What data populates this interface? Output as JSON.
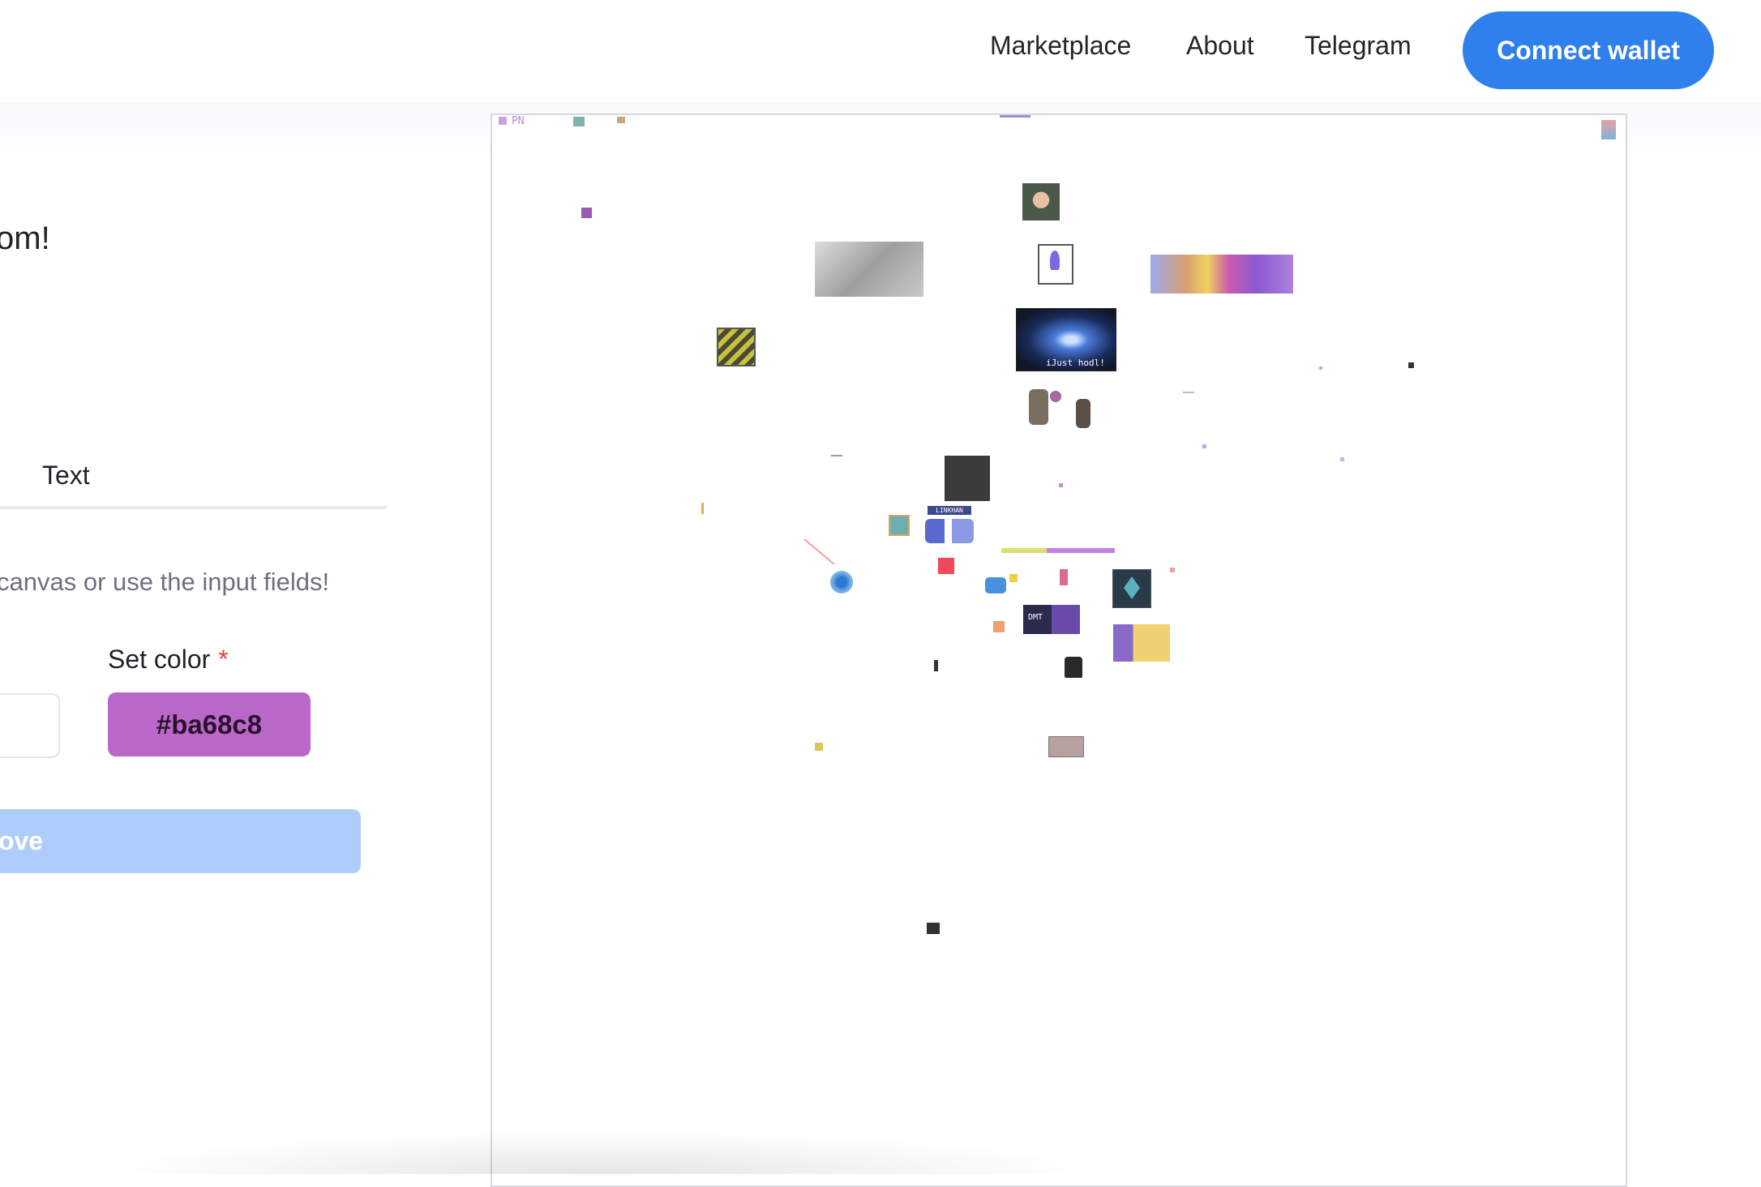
{
  "nav": {
    "marketplace_label": "Marketplace",
    "about_label": "About",
    "telegram_label": "Telegram",
    "connect_label": "Connect wallet"
  },
  "panel": {
    "heading_fragment": "om!",
    "tab_label": "Text",
    "hint_fragment": "canvas or use the input fields!",
    "color_label": "Set color",
    "required_mark": "*",
    "color_value": "#ba68c8",
    "save_fragment": "ove"
  },
  "colors": {
    "accent": "#2f80ed",
    "selected_color": "#ba68c8",
    "save_disabled": "#aecdfb"
  },
  "canvas_text": {
    "pn_tag": "PN",
    "dmt_label": "DMT",
    "linkhan_label": "LINKHAN",
    "just_label": "iJust hodl!"
  }
}
